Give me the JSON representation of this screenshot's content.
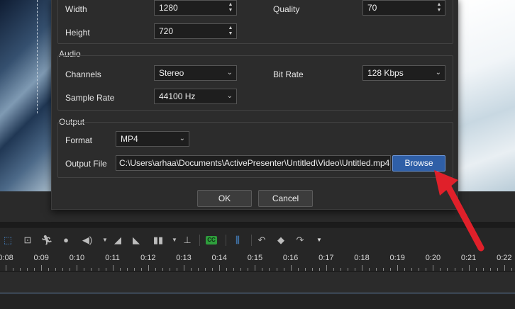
{
  "video": {
    "width_label": "Width",
    "width_value": "1280",
    "height_label": "Height",
    "height_value": "720",
    "quality_label": "Quality",
    "quality_value": "70"
  },
  "audio": {
    "title": "Audio",
    "channels_label": "Channels",
    "channels_value": "Stereo",
    "bitrate_label": "Bit Rate",
    "bitrate_value": "128 Kbps",
    "samplerate_label": "Sample Rate",
    "samplerate_value": "44100 Hz"
  },
  "output": {
    "title": "Output",
    "format_label": "Format",
    "format_value": "MP4",
    "file_label": "Output File",
    "file_value": "C:\\Users\\arhaa\\Documents\\ActivePresenter\\Untitled\\Video\\Untitled.mp4",
    "browse_label": "Browse"
  },
  "dialog": {
    "ok_label": "OK",
    "cancel_label": "Cancel"
  },
  "timeline": {
    "ticks": [
      "0:08",
      "0:09",
      "0:10",
      "0:11",
      "0:12",
      "0:13",
      "0:14",
      "0:15",
      "0:16",
      "0:17",
      "0:18",
      "0:19",
      "0:20",
      "0:21",
      "0:22"
    ]
  },
  "toolbar": {
    "cc_label": "CC",
    "icons": [
      "crop-icon",
      "zoom-n-pan-icon",
      "run-icon",
      "drop-icon",
      "volume-icon",
      "fade-in-icon",
      "fade-out-icon",
      "audio-levels-icon",
      "normalize-icon",
      "closed-caption-icon",
      "split-icon",
      "undo-icon",
      "diamond-icon",
      "redo-icon",
      "more-icon"
    ]
  },
  "colors": {
    "accent": "#2f5fa7",
    "annotation": "#e0202a",
    "cc": "#2e9e3c"
  }
}
